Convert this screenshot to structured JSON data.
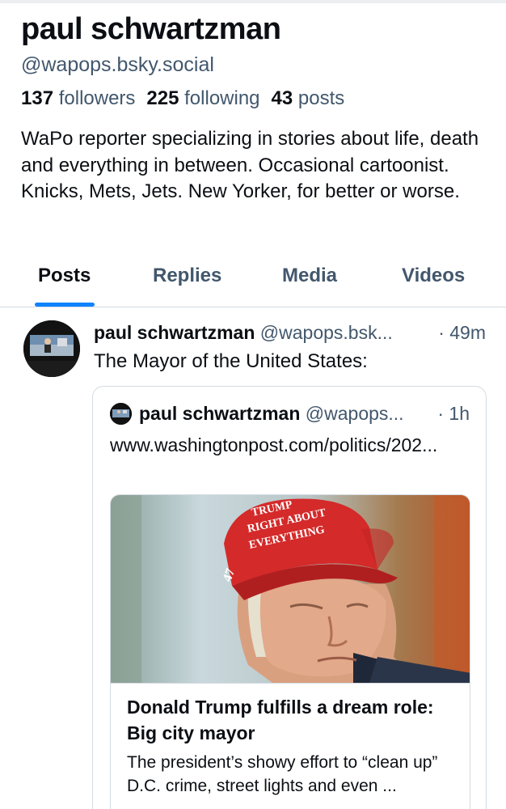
{
  "profile": {
    "display_name": "paul schwartzman",
    "handle": "@wapops.bsky.social",
    "followers_count": "137",
    "followers_label": "followers",
    "following_count": "225",
    "following_label": "following",
    "posts_count": "43",
    "posts_label": "posts",
    "bio": "WaPo reporter specializing in stories about life, death and everything in between. Occasional cartoonist. Knicks, Mets, Jets. New Yorker, for better or worse."
  },
  "tabs": [
    {
      "label": "Posts",
      "active": true
    },
    {
      "label": "Replies",
      "active": false
    },
    {
      "label": "Media",
      "active": false
    },
    {
      "label": "Videos",
      "active": false
    }
  ],
  "post": {
    "author_name": "paul schwartzman",
    "author_handle": "@wapops.bsk...",
    "time": "· 49m",
    "text": "The Mayor of the United States:",
    "quote": {
      "author_name": "paul schwartzman",
      "author_handle": "@wapops...",
      "time": "· 1h",
      "link_text": "www.washingtonpost.com/politics/202...",
      "card": {
        "hat_text": [
          "TRUMP",
          "RIGHT ABOUT",
          "EVERYTHING"
        ],
        "hat_side": "47",
        "title": "Donald Trump fulfills a dream role: Big city mayor",
        "description": "The president’s showy effort to “clean up” D.C. crime, street lights and even ..."
      }
    }
  },
  "colors": {
    "text": "#0b0f14",
    "muted": "#42576c",
    "accent": "#1083fe",
    "border": "#d4dbe2",
    "hat_red": "#d42a2a"
  }
}
